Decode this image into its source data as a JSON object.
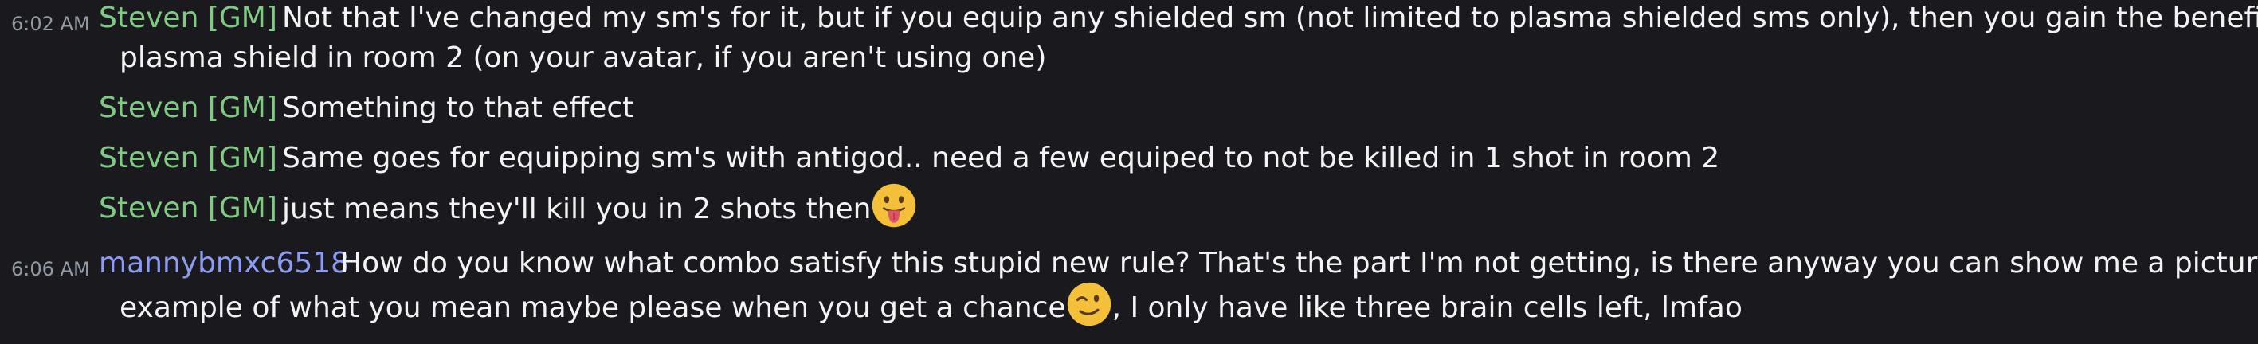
{
  "messages": [
    {
      "timestamp": "6:02 AM",
      "author": "Steven [GM]",
      "line1": "Not that I've changed my sm's for it, but if you equip any shielded sm (not limited to plasma shielded sms only), then you gain the benefit of a",
      "line2": "plasma shield in room 2 (on your avatar, if you aren't using one)"
    },
    {
      "author": "Steven [GM]",
      "text": "Something to that effect"
    },
    {
      "author": "Steven [GM]",
      "text": "Same goes for equipping sm's with antigod.. need a few equiped to not be killed in 1 shot in room 2"
    },
    {
      "author": "Steven [GM]",
      "text": "just means they'll kill you in 2 shots then",
      "emoji": "tongue-out-face"
    },
    {
      "timestamp": "6:06 AM",
      "author": "mannybmxc6518",
      "line1": "How do you know what combo satisfy this stupid new rule? That's the part I'm not getting, is there anyway you can show me a picture",
      "line2_before": "example of what you mean maybe please when you get a chance",
      "emoji": "winking-face",
      "line2_after": ", I only have like three brain cells left, lmfao"
    }
  ],
  "colors": {
    "background": "#1a1a1e",
    "gm_name": "#7fcb84",
    "user_name": "#8c9cf2",
    "timestamp": "#949ba4",
    "text": "#f2f3f5"
  }
}
